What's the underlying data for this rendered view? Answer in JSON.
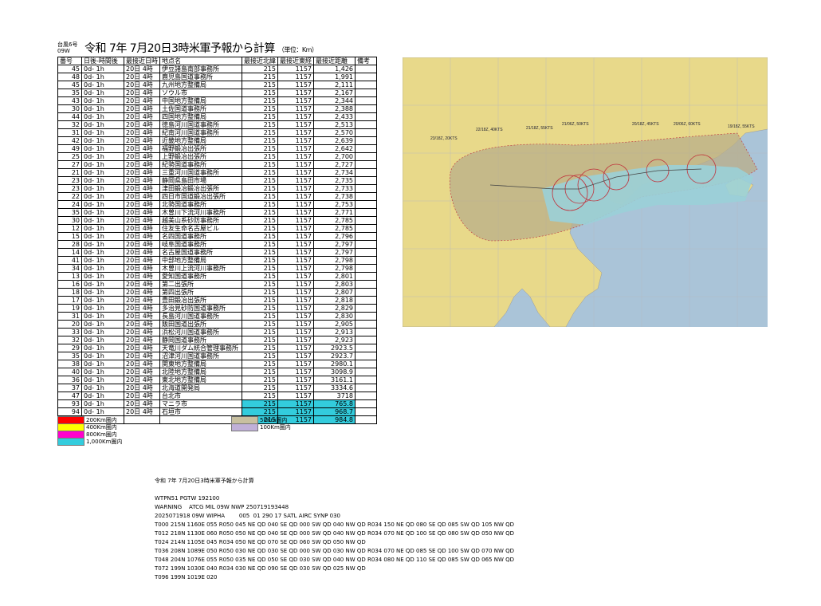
{
  "header": {
    "small_label": "台風6号 09W",
    "title": "令和 7年 7月20日3時米軍予報から計算",
    "unit": "（単位：Km）"
  },
  "table": {
    "columns": [
      "番号",
      "日後-時間後",
      "最接近日時",
      "地点名",
      "最接近北緯",
      "最接近東経",
      "最接近距離",
      "備考"
    ],
    "rows": [
      [
        "45",
        "0d- 1h",
        "20日 4時",
        "伊豆諸島南部事務所",
        "215",
        "1157",
        "1,426",
        "",
        false
      ],
      [
        "48",
        "0d- 1h",
        "20日 4時",
        "鹿児島国道事務所",
        "215",
        "1157",
        "1,991",
        "",
        false
      ],
      [
        "45",
        "0d- 1h",
        "20日 4時",
        "九州地方整備局",
        "215",
        "1157",
        "2,111",
        "",
        false
      ],
      [
        "35",
        "0d- 1h",
        "20日 4時",
        "ソウル市",
        "215",
        "1157",
        "2,167",
        "",
        false
      ],
      [
        "43",
        "0d- 1h",
        "20日 4時",
        "中国地方整備局",
        "215",
        "1157",
        "2,344",
        "",
        false
      ],
      [
        "30",
        "0d- 1h",
        "20日 4時",
        "土佐国道事務所",
        "215",
        "1157",
        "2,388",
        "",
        false
      ],
      [
        "44",
        "0d- 1h",
        "20日 4時",
        "四国地方整備局",
        "215",
        "1157",
        "2,433",
        "",
        false
      ],
      [
        "32",
        "0d- 1h",
        "20日 4時",
        "徳島河川国道事務所",
        "215",
        "1157",
        "2,513",
        "",
        false
      ],
      [
        "31",
        "0d- 1h",
        "20日 4時",
        "紀南河川国道事務所",
        "215",
        "1157",
        "2,570",
        "",
        false
      ],
      [
        "42",
        "0d- 1h",
        "20日 4時",
        "近畿地方整備局",
        "215",
        "1157",
        "2,639",
        "",
        false
      ],
      [
        "49",
        "0d- 1h",
        "20日 4時",
        "福野鍛冶出張所",
        "215",
        "1157",
        "2,642",
        "",
        false
      ],
      [
        "25",
        "0d- 1h",
        "20日 4時",
        "上野鍛冶出張所",
        "215",
        "1157",
        "2,700",
        "",
        false
      ],
      [
        "27",
        "0d- 1h",
        "20日 4時",
        "紀勢国道事務所",
        "215",
        "1157",
        "2,727",
        "",
        false
      ],
      [
        "21",
        "0d- 1h",
        "20日 4時",
        "三重河川国道事務所",
        "215",
        "1157",
        "2,734",
        "",
        false
      ],
      [
        "23",
        "0d- 1h",
        "20日 4時",
        "静岡県島田市場",
        "215",
        "1157",
        "2,735",
        "",
        false
      ],
      [
        "23",
        "0d- 1h",
        "20日 4時",
        "津田鍛冶鍛冶出張所",
        "215",
        "1157",
        "2,733",
        "",
        false
      ],
      [
        "22",
        "0d- 1h",
        "20日 4時",
        "四日市国道鍛冶出張所",
        "215",
        "1157",
        "2,738",
        "",
        false
      ],
      [
        "24",
        "0d- 1h",
        "20日 4時",
        "北勢国道事務所",
        "215",
        "1157",
        "2,753",
        "",
        false
      ],
      [
        "35",
        "0d- 1h",
        "20日 4時",
        "木曽川下流河川事務所",
        "215",
        "1157",
        "2,771",
        "",
        false
      ],
      [
        "30",
        "0d- 1h",
        "20日 4時",
        "越美山系砂防事務所",
        "215",
        "1157",
        "2,785",
        "",
        false
      ],
      [
        "12",
        "0d- 1h",
        "20日 4時",
        "住友生命名古屋ビル",
        "215",
        "1157",
        "2,785",
        "",
        false
      ],
      [
        "15",
        "0d- 1h",
        "20日 4時",
        "名四国道事務所",
        "215",
        "1157",
        "2,796",
        "",
        false
      ],
      [
        "28",
        "0d- 1h",
        "20日 4時",
        "岐阜国道事務所",
        "215",
        "1157",
        "2,797",
        "",
        false
      ],
      [
        "14",
        "0d- 1h",
        "20日 4時",
        "名古屋国道事務所",
        "215",
        "1157",
        "2,797",
        "",
        false
      ],
      [
        "41",
        "0d- 1h",
        "20日 4時",
        "中部地方整備局",
        "215",
        "1157",
        "2,798",
        "",
        false
      ],
      [
        "34",
        "0d- 1h",
        "20日 4時",
        "木曽川上流河川事務所",
        "215",
        "1157",
        "2,798",
        "",
        false
      ],
      [
        "13",
        "0d- 1h",
        "20日 4時",
        "愛知国道事務所",
        "215",
        "1157",
        "2,801",
        "",
        false
      ],
      [
        "16",
        "0d- 1h",
        "20日 4時",
        "第二出張所",
        "215",
        "1157",
        "2,803",
        "",
        false
      ],
      [
        "18",
        "0d- 1h",
        "20日 4時",
        "第四出張所",
        "215",
        "1157",
        "2,807",
        "",
        false
      ],
      [
        "17",
        "0d- 1h",
        "20日 4時",
        "豊田鍛冶出張所",
        "215",
        "1157",
        "2,818",
        "",
        false
      ],
      [
        "19",
        "0d- 1h",
        "20日 4時",
        "多治見砂防国道事務所",
        "215",
        "1157",
        "2,829",
        "",
        false
      ],
      [
        "31",
        "0d- 1h",
        "20日 4時",
        "長島河川国道事務所",
        "215",
        "1157",
        "2,830",
        "",
        false
      ],
      [
        "20",
        "0d- 1h",
        "20日 4時",
        "飯田国道出張所",
        "215",
        "1157",
        "2,905",
        "",
        false
      ],
      [
        "33",
        "0d- 1h",
        "20日 4時",
        "浜松河川国道事務所",
        "215",
        "1157",
        "2,913",
        "",
        false
      ],
      [
        "32",
        "0d- 1h",
        "20日 4時",
        "静岡国道事務所",
        "215",
        "1157",
        "2,923",
        "",
        false
      ],
      [
        "29",
        "0d- 1h",
        "20日 4時",
        "天竜川ダム統合管理事務所",
        "215",
        "1157",
        "2923.5",
        "",
        false
      ],
      [
        "35",
        "0d- 1h",
        "20日 4時",
        "沼津河川国道事務所",
        "215",
        "1157",
        "2923.7",
        "",
        false
      ],
      [
        "38",
        "0d- 1h",
        "20日 4時",
        "関東地方整備局",
        "215",
        "1157",
        "2980.1",
        "",
        false
      ],
      [
        "40",
        "0d- 1h",
        "20日 4時",
        "北陸地方整備局",
        "215",
        "1157",
        "3098.9",
        "",
        false
      ],
      [
        "36",
        "0d- 1h",
        "20日 4時",
        "東北地方整備局",
        "215",
        "1157",
        "3161.1",
        "",
        false
      ],
      [
        "37",
        "0d- 1h",
        "20日 4時",
        "北海道開発局",
        "215",
        "1157",
        "3334.6",
        "",
        false
      ],
      [
        "47",
        "0d- 1h",
        "20日 4時",
        "台北市",
        "215",
        "1157",
        "3718",
        "",
        false
      ],
      [
        "93",
        "0d- 1h",
        "20日 4時",
        "マニラ市",
        "215",
        "1157",
        "765.8",
        "",
        true
      ],
      [
        "94",
        "0d- 1h",
        "20日 4時",
        "石垣市",
        "215",
        "1157",
        "968.7",
        "",
        true
      ],
      [
        "",
        "",
        "",
        "",
        "215",
        "1157",
        "984.8",
        "",
        true
      ]
    ]
  },
  "legend_left": [
    {
      "label": "200Km圏内",
      "color": "#ff0000"
    },
    {
      "label": "400Km圏内",
      "color": "#ffff00"
    },
    {
      "label": "800Km圏内",
      "color": "#ff00cc"
    },
    {
      "label": "1,000Km圏内",
      "color": "#33ccdd"
    }
  ],
  "legend_right": [
    {
      "label": "50Km圏内",
      "color": "#c8c0a0"
    },
    {
      "label": "100Km圏内",
      "color": "#c0b0d8"
    }
  ],
  "map": {
    "labels": [
      "19/18Z, 55KTS",
      "20/06Z, 60KTS",
      "20/18Z, 45KTS",
      "21/06Z, 50KTS",
      "21/18Z, 55KTS",
      "22/18Z, 40KTS",
      "23/18Z, 20KTS"
    ],
    "colors": {
      "land": "#e8d98a",
      "sea": "#aac4d8",
      "cone": "#b9ad88",
      "wind": "#9ad0d8",
      "track": "#c0303a"
    }
  },
  "report": {
    "lines": [
      "令和 7年 7月20日3時米軍予報から計算",
      "",
      "WTPN51 PGTW 192100",
      "WARNING    ATCG MIL 09W NWP 250719193448",
      "2025071918 09W WIPHA        005  01 290 17 SATL AIRC SYNP 030",
      "T000 215N 1160E 055 R050 045 NE QD 040 SE QD 000 SW QD 040 NW QD R034 150 NE QD 080 SE QD 085 SW QD 105 NW QD",
      "T012 218N 1130E 060 R050 050 NE QD 040 SE QD 000 SW QD 040 NW QD R034 070 NE QD 100 SE QD 080 SW QD 050 NW QD",
      "T024 214N 1105E 045 R034 050 NE QD 070 SE QD 060 SW QD 050 NW QD",
      "T036 208N 1089E 050 R050 030 NE QD 030 SE QD 000 SW QD 030 NW QD R034 070 NE QD 085 SE QD 100 SW QD 070 NW QD",
      "T048 204N 1076E 055 R050 035 NE QD 050 SE QD 030 SW QD 040 NW QD R034 080 NE QD 110 SE QD 085 SW QD 065 NW QD",
      "T072 199N 1030E 040 R034 030 NE QD 090 SE QD 030 SW QD 025 NW QD",
      "T096 199N 1019E 020"
    ]
  }
}
